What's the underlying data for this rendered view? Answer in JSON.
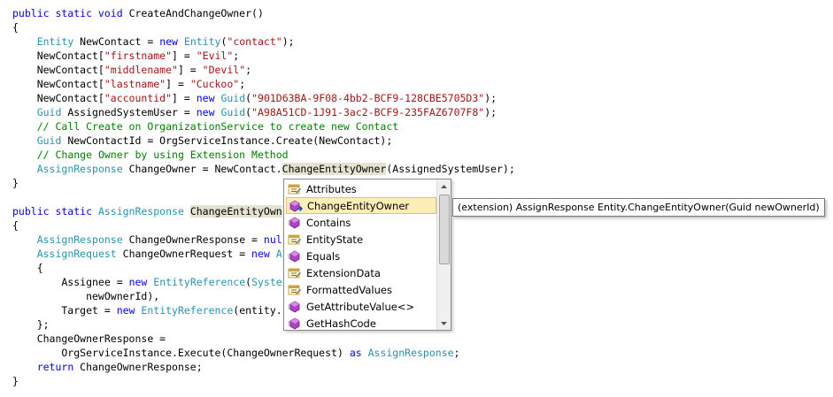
{
  "code": {
    "lines": [
      [
        {
          "t": "public static void ",
          "c": "kw0"
        },
        {
          "t": "CreateAndChangeOwner()",
          "c": ""
        }
      ],
      [
        {
          "t": "{",
          "c": ""
        }
      ],
      [
        {
          "t": "    ",
          "c": ""
        },
        {
          "t": "Entity",
          "c": "ty"
        },
        {
          "t": " NewContact = ",
          "c": ""
        },
        {
          "t": "new",
          "c": "kw"
        },
        {
          "t": " ",
          "c": ""
        },
        {
          "t": "Entity",
          "c": "ty"
        },
        {
          "t": "(",
          "c": ""
        },
        {
          "t": "\"contact\"",
          "c": "st"
        },
        {
          "t": ");",
          "c": ""
        }
      ],
      [
        {
          "t": "    NewContact[",
          "c": ""
        },
        {
          "t": "\"firstname\"",
          "c": "st"
        },
        {
          "t": "] = ",
          "c": ""
        },
        {
          "t": "\"Evil\"",
          "c": "st"
        },
        {
          "t": ";",
          "c": ""
        }
      ],
      [
        {
          "t": "    NewContact[",
          "c": ""
        },
        {
          "t": "\"middlename\"",
          "c": "st"
        },
        {
          "t": "] = ",
          "c": ""
        },
        {
          "t": "\"Devil\"",
          "c": "st"
        },
        {
          "t": ";",
          "c": ""
        }
      ],
      [
        {
          "t": "    NewContact[",
          "c": ""
        },
        {
          "t": "\"lastname\"",
          "c": "st"
        },
        {
          "t": "] = ",
          "c": ""
        },
        {
          "t": "\"Cuckoo\"",
          "c": "st"
        },
        {
          "t": ";",
          "c": ""
        }
      ],
      [
        {
          "t": "    NewContact[",
          "c": ""
        },
        {
          "t": "\"accountid\"",
          "c": "st"
        },
        {
          "t": "] = ",
          "c": ""
        },
        {
          "t": "new",
          "c": "kw"
        },
        {
          "t": " ",
          "c": ""
        },
        {
          "t": "Guid",
          "c": "ty"
        },
        {
          "t": "(",
          "c": ""
        },
        {
          "t": "\"901D63BA-9F08-4bb2-BCF9-128CBE5705D3\"",
          "c": "st"
        },
        {
          "t": ");",
          "c": ""
        }
      ],
      [
        {
          "t": "    ",
          "c": ""
        },
        {
          "t": "Guid",
          "c": "ty"
        },
        {
          "t": " AssignedSystemUser = ",
          "c": ""
        },
        {
          "t": "new",
          "c": "kw"
        },
        {
          "t": " ",
          "c": ""
        },
        {
          "t": "Guid",
          "c": "ty"
        },
        {
          "t": "(",
          "c": ""
        },
        {
          "t": "\"A98A51CD-1J91-3ac2-BCF9-235FAZ6707F8\"",
          "c": "st"
        },
        {
          "t": ");",
          "c": ""
        }
      ],
      [
        {
          "t": "    ",
          "c": ""
        },
        {
          "t": "// Call Create on OrganizationService to create new Contact",
          "c": "cm"
        }
      ],
      [
        {
          "t": "    ",
          "c": ""
        },
        {
          "t": "Guid",
          "c": "ty"
        },
        {
          "t": " NewContactId = OrgServiceInstance.Create(NewContact);",
          "c": ""
        }
      ],
      [
        {
          "t": "    ",
          "c": ""
        },
        {
          "t": "// Change Owner by using Extension Method",
          "c": "cm"
        }
      ],
      [
        {
          "t": "    ",
          "c": ""
        },
        {
          "t": "AssignResponse",
          "c": "ty"
        },
        {
          "t": " ChangeOwner = NewContact.",
          "c": ""
        },
        {
          "t": "ChangeEntityOwner",
          "c": "hl"
        },
        {
          "t": "(AssignedSystemUser);",
          "c": ""
        }
      ],
      [
        {
          "t": "}",
          "c": ""
        }
      ],
      [
        {
          "t": "",
          "c": ""
        }
      ],
      [
        {
          "t": "public static ",
          "c": "kw"
        },
        {
          "t": "AssignResponse",
          "c": "ty"
        },
        {
          "t": " ",
          "c": ""
        },
        {
          "t": "ChangeEntityOwn",
          "c": "hl"
        }
      ],
      [
        {
          "t": "{",
          "c": ""
        }
      ],
      [
        {
          "t": "    ",
          "c": ""
        },
        {
          "t": "AssignResponse",
          "c": "ty"
        },
        {
          "t": " ChangeOwnerResponse = ",
          "c": ""
        },
        {
          "t": "nul",
          "c": "kw"
        }
      ],
      [
        {
          "t": "    ",
          "c": ""
        },
        {
          "t": "AssignRequest",
          "c": "ty"
        },
        {
          "t": " ChangeOwnerRequest = ",
          "c": ""
        },
        {
          "t": "new",
          "c": "kw"
        },
        {
          "t": " ",
          "c": ""
        },
        {
          "t": "A",
          "c": "ty"
        }
      ],
      [
        {
          "t": "    {",
          "c": ""
        }
      ],
      [
        {
          "t": "        Assignee = ",
          "c": ""
        },
        {
          "t": "new",
          "c": "kw"
        },
        {
          "t": " ",
          "c": ""
        },
        {
          "t": "EntityReference",
          "c": "ty"
        },
        {
          "t": "(",
          "c": ""
        },
        {
          "t": "Syste",
          "c": "ty"
        }
      ],
      [
        {
          "t": "            newOwnerId),",
          "c": ""
        }
      ],
      [
        {
          "t": "        Target = ",
          "c": ""
        },
        {
          "t": "new",
          "c": "kw"
        },
        {
          "t": " ",
          "c": ""
        },
        {
          "t": "EntityReference",
          "c": "ty"
        },
        {
          "t": "(entity.",
          "c": ""
        }
      ],
      [
        {
          "t": "    };",
          "c": ""
        }
      ],
      [
        {
          "t": "    ChangeOwnerResponse =",
          "c": ""
        }
      ],
      [
        {
          "t": "        OrgServiceInstance.Execute(ChangeOwnerRequest) ",
          "c": ""
        },
        {
          "t": "as",
          "c": "kw"
        },
        {
          "t": " ",
          "c": ""
        },
        {
          "t": "AssignResponse",
          "c": "ty"
        },
        {
          "t": ";",
          "c": ""
        }
      ],
      [
        {
          "t": "    ",
          "c": ""
        },
        {
          "t": "return",
          "c": "kw"
        },
        {
          "t": " ChangeOwnerResponse;",
          "c": ""
        }
      ],
      [
        {
          "t": "}",
          "c": ""
        }
      ]
    ]
  },
  "intellisense": {
    "items": [
      {
        "label": "Attributes",
        "icon": "property-icon",
        "selected": false
      },
      {
        "label": "ChangeEntityOwner",
        "icon": "extension-method-icon",
        "selected": true
      },
      {
        "label": "Contains",
        "icon": "method-icon",
        "selected": false
      },
      {
        "label": "EntityState",
        "icon": "property-icon",
        "selected": false
      },
      {
        "label": "Equals",
        "icon": "method-icon",
        "selected": false
      },
      {
        "label": "ExtensionData",
        "icon": "property-icon",
        "selected": false
      },
      {
        "label": "FormattedValues",
        "icon": "property-icon",
        "selected": false
      },
      {
        "label": "GetAttributeValue<>",
        "icon": "method-icon",
        "selected": false
      },
      {
        "label": "GetHashCode",
        "icon": "method-icon",
        "selected": false
      }
    ]
  },
  "tooltip": {
    "text": "(extension) AssignResponse Entity.ChangeEntityOwner(Guid newOwnerId)"
  },
  "colors": {
    "keyword": "#0000ff",
    "type": "#2b91af",
    "string": "#a31515",
    "comment": "#008000",
    "method_icon": "#b042c8",
    "property_icon": "#c9a44a",
    "selection": "#fdeeb8"
  }
}
